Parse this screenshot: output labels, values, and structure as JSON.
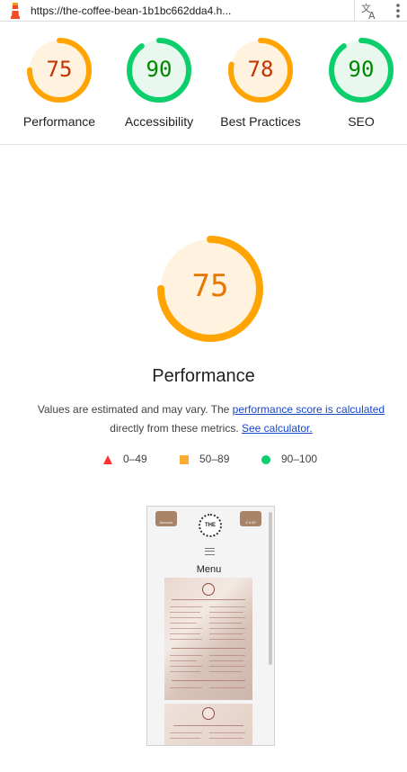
{
  "topbar": {
    "url": "https://the-coffee-bean-1b1bc662dda4.h...",
    "translate_icon": "translate-icon",
    "menu_icon": "more-vert-icon"
  },
  "gauges": [
    {
      "label": "Performance",
      "score": "75",
      "value": 75,
      "rating": "average"
    },
    {
      "label": "Accessibility",
      "score": "90",
      "value": 90,
      "rating": "pass"
    },
    {
      "label": "Best Practices",
      "score": "78",
      "value": 78,
      "rating": "average"
    },
    {
      "label": "SEO",
      "score": "90",
      "value": 90,
      "rating": "pass"
    }
  ],
  "colors": {
    "average_stroke": "#ffa400",
    "average_fill": "#fff3e0",
    "average_text": "#c33300",
    "pass_stroke": "#0cce6b",
    "pass_fill": "#e8f8ef",
    "pass_text": "#008800",
    "link": "#1a47c6"
  },
  "main": {
    "score": "75",
    "value": 75,
    "title": "Performance",
    "desc_prefix": "Values are estimated and may vary. The ",
    "desc_link1": "performance score is calculated",
    "desc_middle": " directly from these metrics. ",
    "desc_link2": "See calculator."
  },
  "legend": {
    "fail": "0–49",
    "average": "50–89",
    "pass": "90–100"
  },
  "thumbnail": {
    "account_label": "Account",
    "bag_label": "£ 0.00",
    "logo_text": "THE",
    "menu_title": "Menu"
  }
}
